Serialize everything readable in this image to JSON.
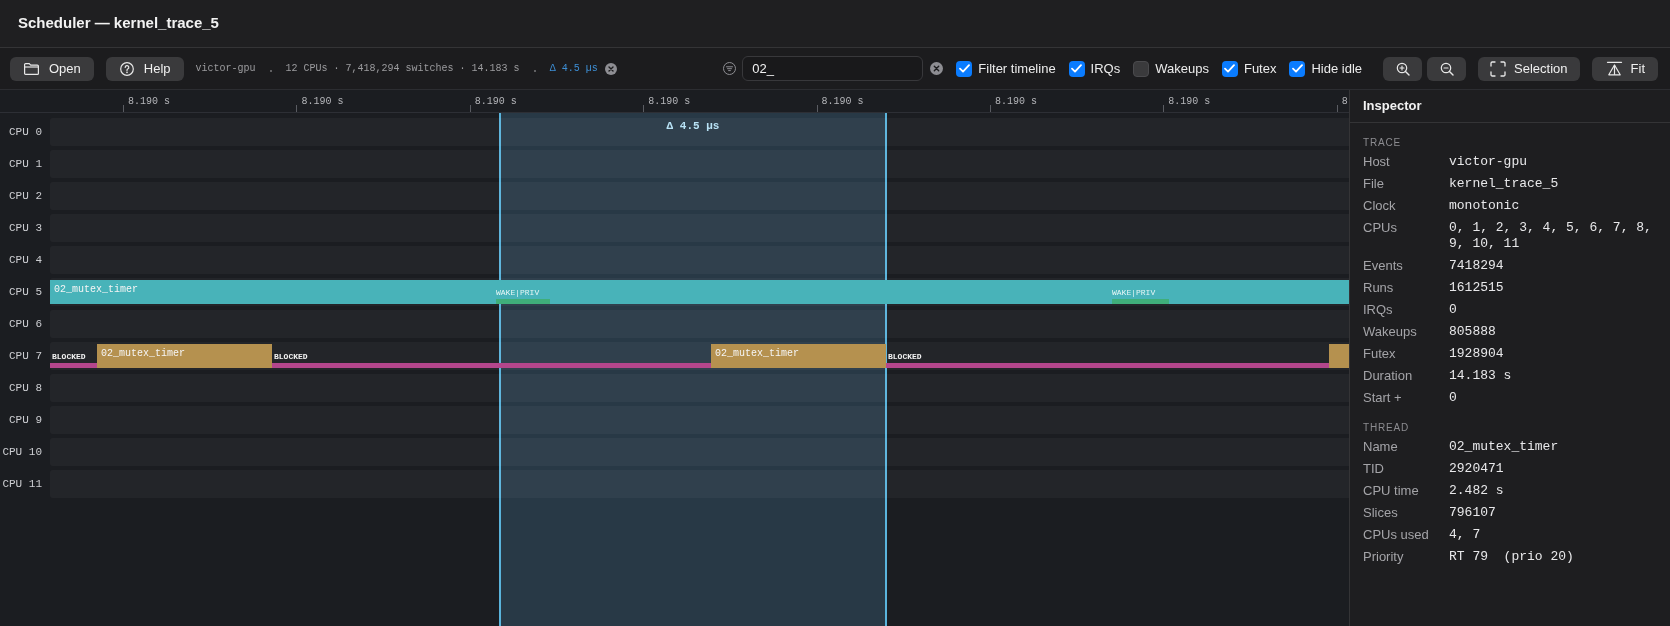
{
  "window": {
    "title": "Scheduler — kernel_trace_5"
  },
  "toolbar": {
    "buttons": [
      {
        "label": "Open"
      },
      {
        "label": "Help"
      }
    ],
    "summary": {
      "host": "victor-gpu",
      "stats": "12 CPUs · 7,418,294 switches · 14.183 s",
      "selection": "Δ 4.5 µs"
    },
    "filter": {
      "value": "02_"
    },
    "toggles": [
      {
        "label": "Filter timeline",
        "checked": true
      },
      {
        "label": "IRQs",
        "checked": true
      },
      {
        "label": "Wakeups",
        "checked": false
      },
      {
        "label": "Futex",
        "checked": true
      },
      {
        "label": "Hide idle",
        "checked": true
      }
    ],
    "view_buttons": [
      {
        "label": "Selection"
      },
      {
        "label": "Fit"
      }
    ]
  },
  "timeline": {
    "ticks": [
      "8.190 s",
      "8.190 s",
      "8.190 s",
      "8.190 s",
      "8.190 s",
      "8.190 s",
      "8.190 s",
      "8"
    ],
    "selection": {
      "label": "Δ 4.5 µs"
    },
    "cpus": [
      {
        "label": "CPU 0"
      },
      {
        "label": "CPU 1"
      },
      {
        "label": "CPU 2"
      },
      {
        "label": "CPU 3"
      },
      {
        "label": "CPU 4"
      },
      {
        "label": "CPU 5",
        "slices": [
          {
            "kind": "run",
            "label": "02_mutex_timer",
            "color": "#48b3b9"
          }
        ],
        "events": [
          {
            "label": "WAKE|PRIV"
          },
          {
            "label": "WAKE|PRIV"
          }
        ]
      },
      {
        "label": "CPU 6"
      },
      {
        "label": "CPU 7",
        "slices": [
          {
            "kind": "blocked",
            "label": "BLOCKED"
          },
          {
            "kind": "run",
            "label": "02_mutex_timer",
            "color": "#b5914f"
          },
          {
            "kind": "blocked",
            "label": "BLOCKED"
          },
          {
            "kind": "run",
            "label": "02_mutex_timer",
            "color": "#b5914f"
          },
          {
            "kind": "blocked",
            "label": "BLOCKED"
          },
          {
            "kind": "run",
            "color": "#b5914f"
          }
        ]
      },
      {
        "label": "CPU 8"
      },
      {
        "label": "CPU 9"
      },
      {
        "label": "CPU 10"
      },
      {
        "label": "CPU 11"
      }
    ]
  },
  "inspector": {
    "title": "Inspector",
    "sections": [
      {
        "title": "TRACE",
        "rows": [
          {
            "label": "Host",
            "value": "victor-gpu"
          },
          {
            "label": "File",
            "value": "kernel_trace_5"
          },
          {
            "label": "Clock",
            "value": "monotonic"
          },
          {
            "label": "CPUs",
            "value": "0, 1, 2, 3, 4, 5, 6, 7, 8, 9, 10, 11"
          },
          {
            "label": "Events",
            "value": "7418294"
          },
          {
            "label": "Runs",
            "value": "1612515"
          },
          {
            "label": "IRQs",
            "value": "0"
          },
          {
            "label": "Wakeups",
            "value": "805888"
          },
          {
            "label": "Futex",
            "value": "1928904"
          },
          {
            "label": "Duration",
            "value": "14.183 s"
          },
          {
            "label": "Start +",
            "value": "0"
          }
        ]
      },
      {
        "title": "THREAD",
        "rows": [
          {
            "label": "Name",
            "value": "02_mutex_timer"
          },
          {
            "label": "TID",
            "value": "2920471"
          },
          {
            "label": "CPU time",
            "value": "2.482 s"
          },
          {
            "label": "Slices",
            "value": "796107"
          },
          {
            "label": "CPUs used",
            "value": "4, 7"
          },
          {
            "label": "Priority",
            "value": "RT 79  (prio 20)"
          }
        ]
      }
    ]
  }
}
